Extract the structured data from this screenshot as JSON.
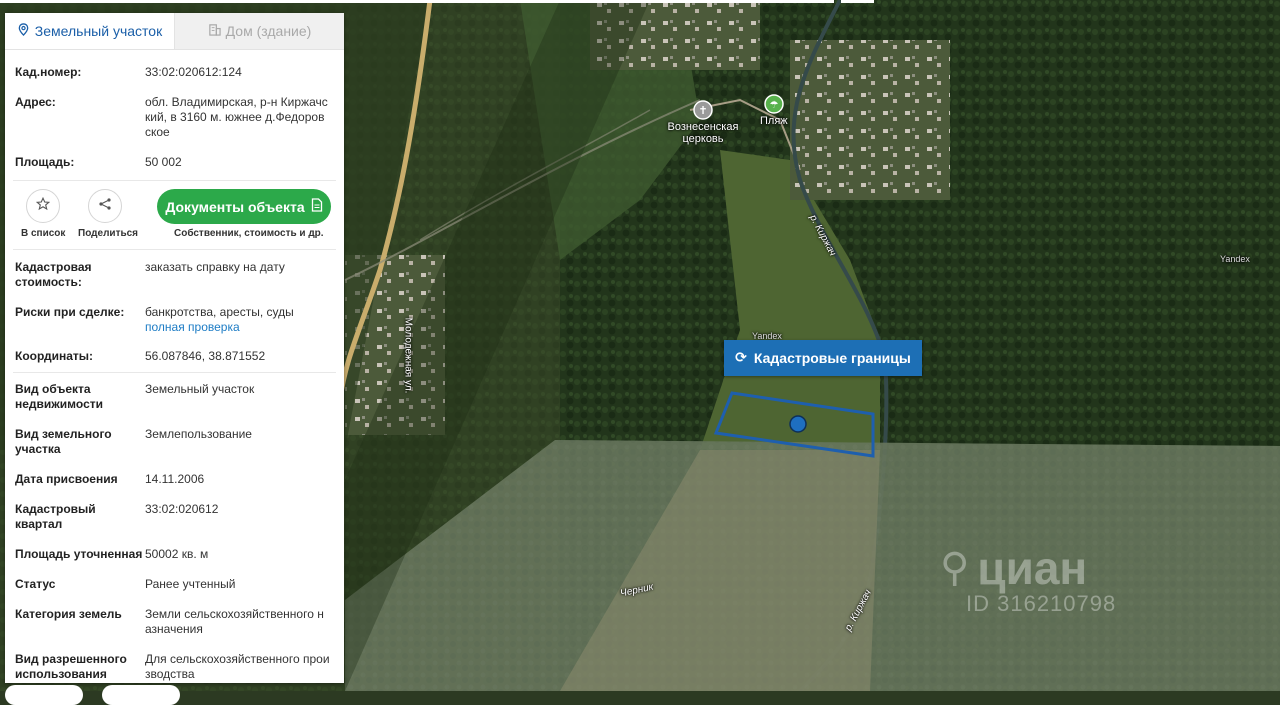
{
  "tabs": [
    {
      "label": "Земельный участок",
      "icon": "map-pin-icon",
      "active": true
    },
    {
      "label": "Дом (здание)",
      "icon": "building-icon",
      "active": false
    }
  ],
  "info_top": [
    {
      "key": "Кад.номер:",
      "value": "33:02:020612:124",
      "link": true
    },
    {
      "key": "Адрес:",
      "value": "обл. Владимирская, р-н Киржачский, в 3160 м. южнее д.Федоровское"
    },
    {
      "key": "Площадь:",
      "value": "50 002"
    }
  ],
  "actions": {
    "favorite_label": "В список",
    "share_label": "Поделиться",
    "documents_label": "Документы объекта",
    "documents_caption": "Собственник, стоимость и др."
  },
  "cadastral_value": {
    "key": "Кадастровая стоимость:",
    "link": "заказать справку на дату"
  },
  "risks": {
    "key": "Риски при сделке:",
    "value": "банкротства, аресты, суды",
    "link": "полная проверка"
  },
  "info_rest": [
    {
      "key": "Координаты:",
      "value": "56.087846, 38.871552"
    },
    {
      "key": "Вид объекта недвижимости",
      "value": "Земельный участок"
    },
    {
      "key": "Вид земельного участка",
      "value": "Землепользование"
    },
    {
      "key": "Дата присвоения",
      "value": "14.11.2006"
    },
    {
      "key": "Кадастровый квартал",
      "value": "33:02:020612"
    },
    {
      "key": "Площадь уточненная",
      "value": "50002 кв. м"
    },
    {
      "key": "Статус",
      "value": "Ранее учтенный"
    },
    {
      "key": "Категория земель",
      "value": "Земли сельскохозяйственного назначения"
    },
    {
      "key": "Вид разрешенного использования",
      "value": "Для сельскохозяйственного производства"
    }
  ],
  "map": {
    "cadastral_button": "Кадастровые границы",
    "labels": {
      "church": "Вознесенская церковь",
      "beach": "Пляж",
      "river1": "р. Киржач",
      "river2": "р. Киржач",
      "street": "Молодежная ул.",
      "chernik": "Черник",
      "yandex1": "Yandex",
      "yandex2": "Yandex"
    },
    "watermark": "циан",
    "watermark_id": "ID 316210798",
    "colors": {
      "boundary": "#1e5fae",
      "button": "#1d6fb5",
      "doc_button": "#2ca94a"
    }
  }
}
